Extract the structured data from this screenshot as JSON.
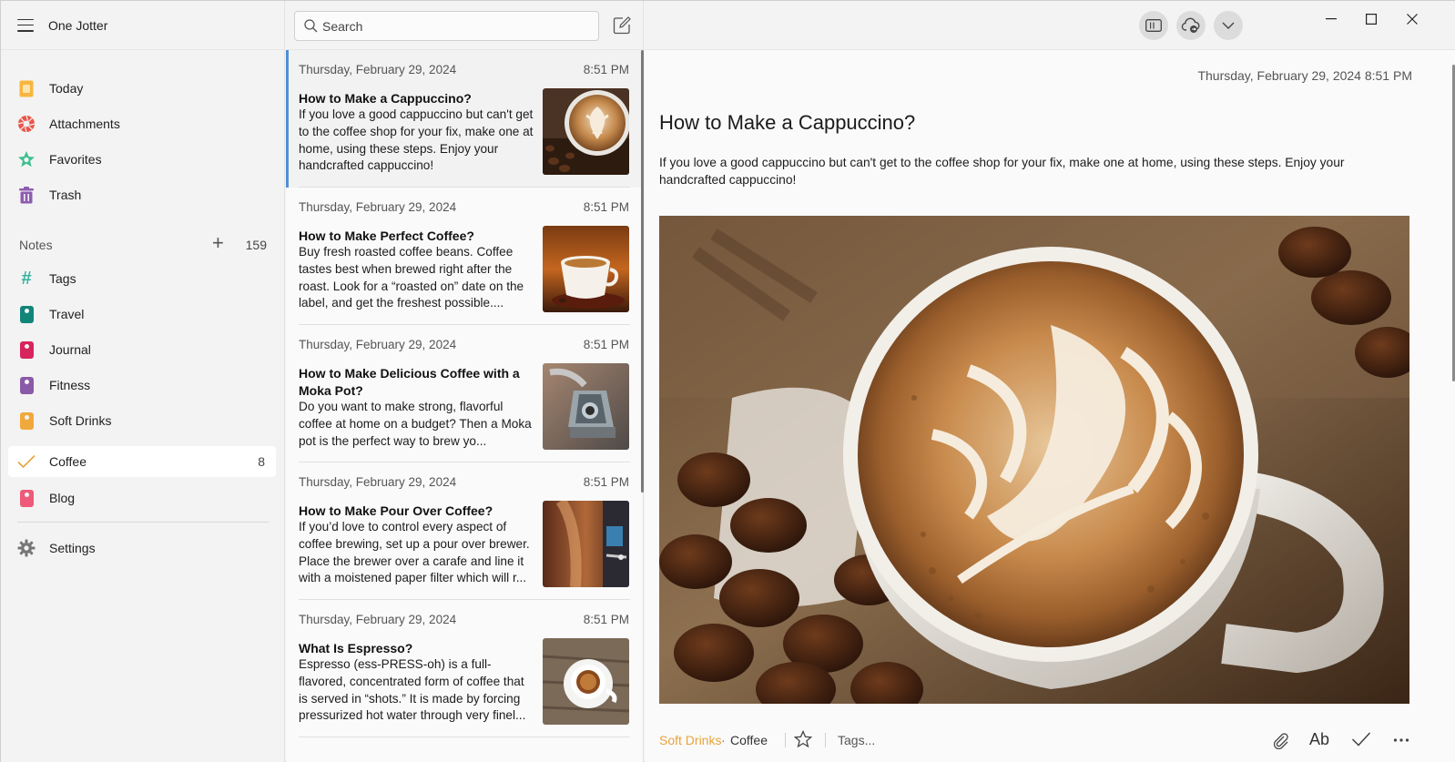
{
  "app": {
    "title": "One Jotter"
  },
  "sidebar": {
    "items": [
      {
        "label": "Today",
        "icon": "today-icon",
        "color": "#f7b63e"
      },
      {
        "label": "Attachments",
        "icon": "attachments-icon",
        "color": "#e9564a"
      },
      {
        "label": "Favorites",
        "icon": "favorites-icon",
        "color": "#3dbf8f"
      },
      {
        "label": "Trash",
        "icon": "trash-icon",
        "color": "#8e5cb0"
      }
    ],
    "notes_header": {
      "label": "Notes",
      "add_icon": "plus-icon",
      "count": "159"
    },
    "notebooks": [
      {
        "label": "Tags",
        "icon": "hash-icon",
        "color": "#36b3a0",
        "count": ""
      },
      {
        "label": "Travel",
        "icon": "tag-icon",
        "color": "#12857a",
        "count": ""
      },
      {
        "label": "Journal",
        "icon": "tag-icon",
        "color": "#d8245c",
        "count": ""
      },
      {
        "label": "Fitness",
        "icon": "tag-icon",
        "color": "#8b5aa7",
        "count": ""
      },
      {
        "label": "Soft Drinks",
        "icon": "tag-icon",
        "color": "#f1a83c",
        "count": ""
      },
      {
        "label": "Coffee",
        "icon": "check-icon",
        "color": "#e8a33a",
        "count": "8",
        "active": true
      },
      {
        "label": "Blog",
        "icon": "tag-icon",
        "color": "#ee5b78",
        "count": ""
      }
    ],
    "settings": {
      "label": "Settings",
      "icon": "gear-icon"
    }
  },
  "search": {
    "placeholder": "Search",
    "value": ""
  },
  "note_list": [
    {
      "date": "Thursday, February 29, 2024",
      "time": "8:51 PM",
      "title": "How to Make a Cappuccino?",
      "body": "If you love a good cappuccino but can't get to the coffee shop for your fix, make one at home, using these steps. Enjoy your handcrafted cappuccino!",
      "thumb": "cappuccino-thumb",
      "selected": true
    },
    {
      "date": "Thursday, February 29, 2024",
      "time": "8:51 PM",
      "title": "How to Make Perfect Coffee?",
      "body": "Buy fresh roasted coffee beans. Coffee tastes best when brewed right after the roast. Look for a “roasted on” date on the label, and get the freshest possible....",
      "thumb": "espresso-cup-thumb"
    },
    {
      "date": "Thursday, February 29, 2024",
      "time": "8:51 PM",
      "title": "How to Make Delicious Coffee with a Moka Pot?",
      "body": "Do you want to make strong, flavorful coffee at home on a budget? Then a Moka pot is the perfect way to brew yo...",
      "thumb": "moka-pot-thumb"
    },
    {
      "date": "Thursday, February 29, 2024",
      "time": "8:51 PM",
      "title": "How to Make Pour Over Coffee?",
      "body": "If you’d love to control every aspect of coffee brewing, set up a pour over brewer. Place the brewer over a carafe and line it with a moistened paper filter which will r...",
      "thumb": "pour-over-thumb"
    },
    {
      "date": "Thursday, February 29, 2024",
      "time": "8:51 PM",
      "title": "What Is Espresso?",
      "body": "Espresso (ess-PRESS-oh) is a full-flavored, concentrated form of coffee that is served in “shots.” It is made by forcing pressurized hot water through very finel...",
      "thumb": "espresso-top-thumb"
    }
  ],
  "detail": {
    "datetime": "Thursday, February 29, 2024 8:51 PM",
    "title": "How to Make a Cappuccino?",
    "body": "If you love a good cappuccino but can't get to the coffee shop for your fix, make one at home, using these steps. Enjoy your handcrafted cappuccino!",
    "image": "cappuccino-latte-art-photo",
    "footer": {
      "notebook": "Soft Drinks",
      "separator": "·",
      "tag": "Coffee",
      "tags_placeholder": "Tags..."
    }
  },
  "colors": {
    "accent_blue": "#4f8fd6",
    "accent_orange": "#e8a33a"
  }
}
